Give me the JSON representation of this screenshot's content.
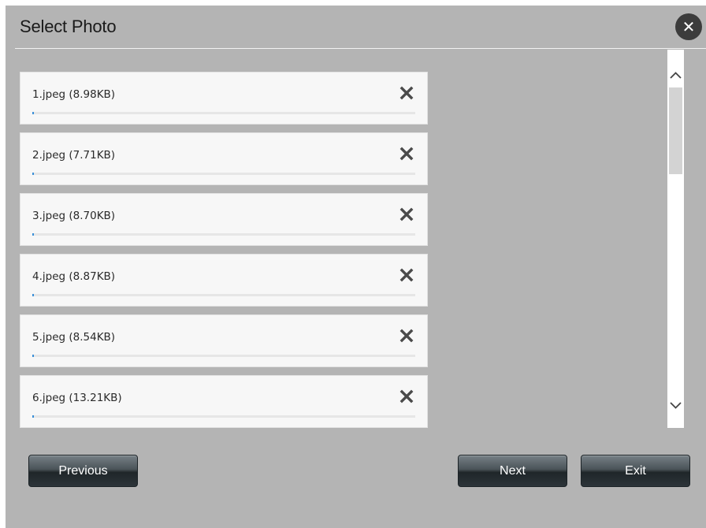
{
  "dialog": {
    "title": "Select Photo",
    "close_label": "✕"
  },
  "files": [
    {
      "name": "1.jpeg (8.98KB)",
      "progress_percent": 0
    },
    {
      "name": "2.jpeg (7.71KB)",
      "progress_percent": 0
    },
    {
      "name": "3.jpeg (8.70KB)",
      "progress_percent": 0
    },
    {
      "name": "4.jpeg (8.87KB)",
      "progress_percent": 0
    },
    {
      "name": "5.jpeg (8.54KB)",
      "progress_percent": 0
    },
    {
      "name": "6.jpeg (13.21KB)",
      "progress_percent": 0
    }
  ],
  "icons": {
    "remove": "close-x-icon",
    "scroll_up": "chevron-up-icon",
    "scroll_down": "chevron-down-icon"
  },
  "buttons": {
    "previous": "Previous",
    "next": "Next",
    "exit": "Exit"
  },
  "colors": {
    "dialog_background": "#b4b4b4",
    "item_background": "#f7f7f7",
    "progress_accent": "#3a8fd8",
    "button_dark": "#2c3439"
  }
}
